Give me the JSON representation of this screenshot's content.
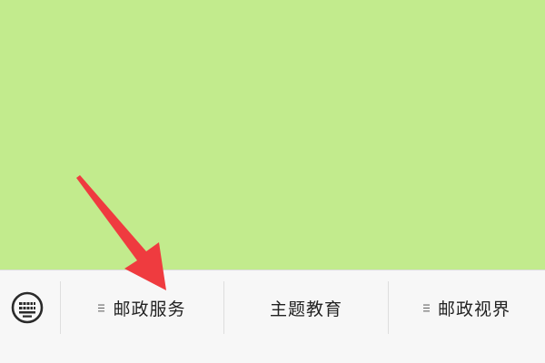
{
  "colors": {
    "content_background": "#c2eb8d",
    "menu_background": "#f7f7f7",
    "annotation_arrow": "#ef3b3f"
  },
  "content": {
    "annotation": "red-arrow-pointing-to-first-menu-item"
  },
  "bottom_menu": {
    "keyboard_icon": "keyboard-icon",
    "items": [
      {
        "label": "邮政服务",
        "has_submenu": true,
        "icon": "submenu-lines-icon"
      },
      {
        "label": "主题教育",
        "has_submenu": false
      },
      {
        "label": "邮政视界",
        "has_submenu": true,
        "icon": "submenu-lines-icon"
      }
    ]
  }
}
